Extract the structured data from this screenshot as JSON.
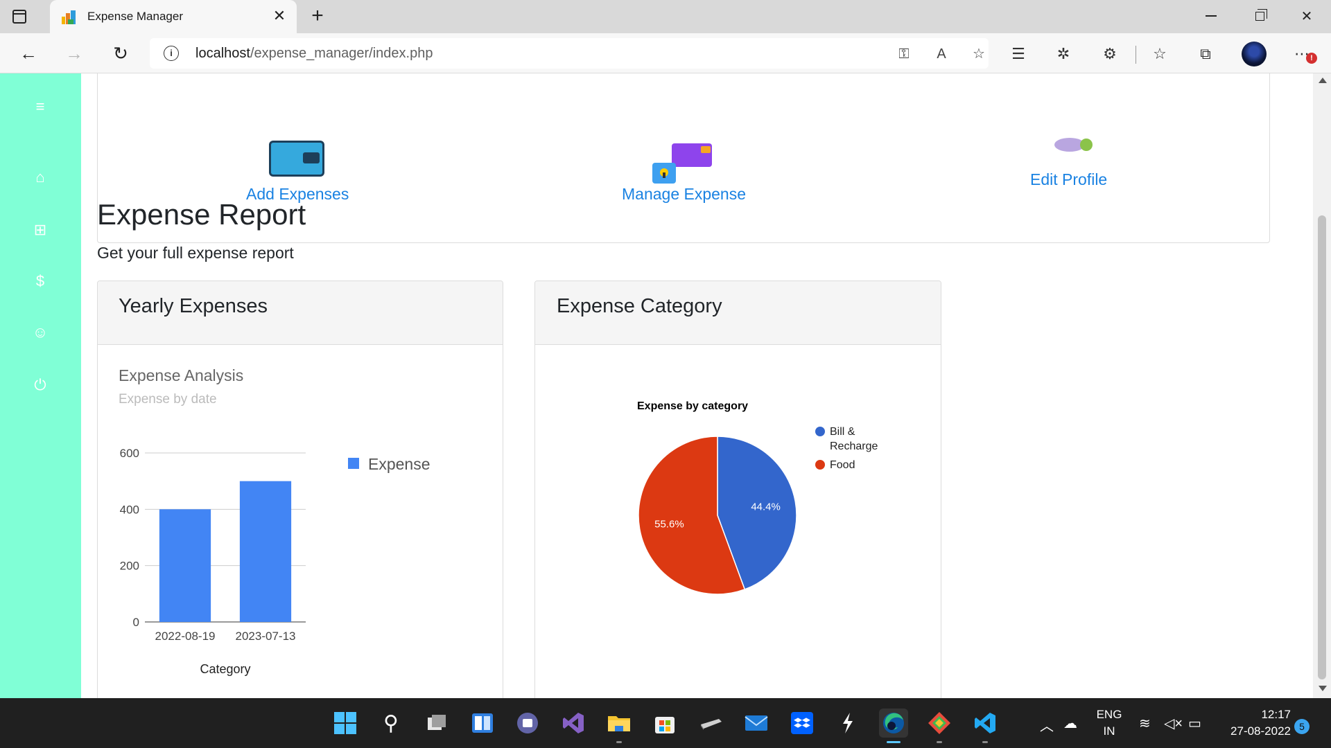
{
  "browser": {
    "tab_title": "Expense Manager",
    "tab_close": "✕",
    "new_tab": "+",
    "url_host": "localhost",
    "url_path": "/expense_manager/index.php",
    "back": "←",
    "forward": "→",
    "reload": "↻"
  },
  "quick_links": {
    "add_expenses": "Add Expenses",
    "manage_expense": "Manage Expense",
    "edit_profile": "Edit Profile"
  },
  "report": {
    "title": "Expense Report",
    "subtitle": "Get your full expense report"
  },
  "cards": {
    "yearly_title": "Yearly Expenses",
    "category_title": "Expense Category"
  },
  "sidebar": {
    "items": [
      {
        "icon": "menu-icon",
        "glyph": "≡"
      },
      {
        "icon": "home-icon",
        "glyph": "⌂"
      },
      {
        "icon": "add-expense-icon",
        "glyph": "⊞"
      },
      {
        "icon": "manage-expense-icon",
        "glyph": "$"
      },
      {
        "icon": "profile-icon",
        "glyph": "☺"
      },
      {
        "icon": "power-icon",
        "glyph": "⏻"
      }
    ]
  },
  "chart_data": [
    {
      "type": "bar",
      "title": "Expense Analysis",
      "subtitle": "Expense by date",
      "categories": [
        "2022-08-19",
        "2023-07-13"
      ],
      "series": [
        {
          "name": "Expense",
          "values": [
            400,
            500
          ],
          "color": "#4285f4"
        }
      ],
      "xlabel": "Category",
      "ylabel": "",
      "ylim": [
        0,
        600
      ],
      "yticks": [
        0,
        200,
        400,
        600
      ],
      "grid": true,
      "legend": "right"
    },
    {
      "type": "pie",
      "title": "Expense by category",
      "slices": [
        {
          "label": "Bill & Recharge",
          "value": 44.4,
          "display": "44.4%",
          "color": "#3366cc"
        },
        {
          "label": "Food",
          "value": 55.6,
          "display": "55.6%",
          "color": "#dc3912"
        }
      ],
      "legend": "right"
    }
  ],
  "taskbar": {
    "lang_1": "ENG",
    "lang_2": "IN",
    "time": "12:17",
    "date": "27-08-2022",
    "notifications": "5"
  }
}
